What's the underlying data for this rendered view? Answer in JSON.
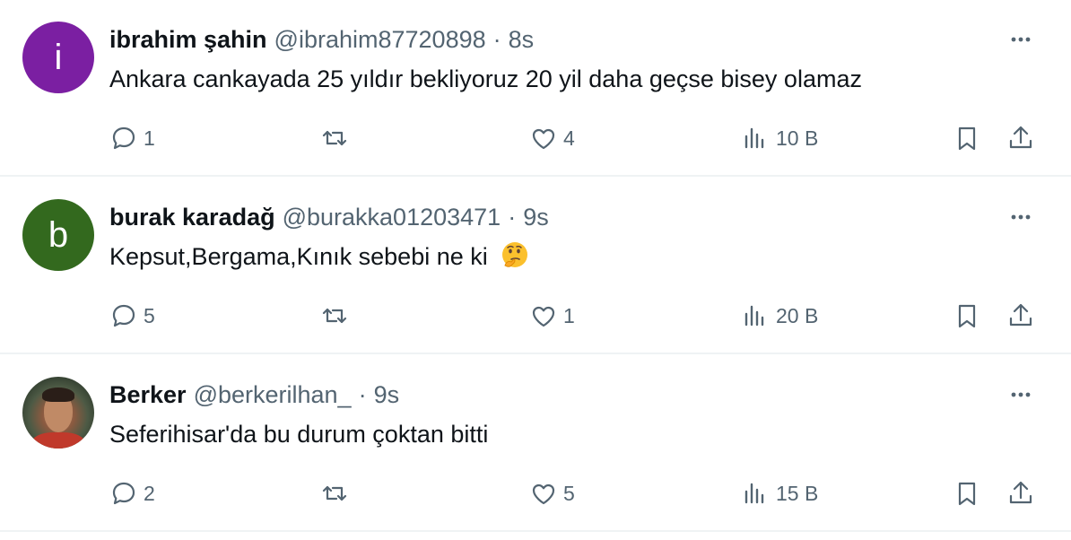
{
  "tweets": [
    {
      "avatar_letter": "i",
      "avatar_color": "#7b1fa2",
      "name": "ibrahim şahin",
      "handle": "@ibrahim87720898",
      "dot": "·",
      "time": "8s",
      "text": "Ankara cankayada 25 yıldır bekliyoruz 20 yil daha geçse bisey olamaz",
      "emoji": "",
      "replies": "1",
      "retweets": "",
      "likes": "4",
      "views": "10 B"
    },
    {
      "avatar_letter": "b",
      "avatar_color": "#33691e",
      "name": "burak karadağ",
      "handle": "@burakka01203471",
      "dot": "·",
      "time": "9s",
      "text": "Kepsut,Bergama,Kınık  sebebi ne ki",
      "emoji": "thinking-face-emoji",
      "replies": "5",
      "retweets": "",
      "likes": "1",
      "views": "20 B"
    },
    {
      "avatar_letter": "",
      "avatar_color": "",
      "name": "Berker",
      "handle": "@berkerilhan_",
      "dot": "·",
      "time": "9s",
      "text": "Seferihisar'da bu durum çoktan bitti",
      "emoji": "",
      "replies": "2",
      "retweets": "",
      "likes": "5",
      "views": "15 B"
    }
  ],
  "icons": {
    "reply": "reply-icon",
    "retweet": "retweet-icon",
    "like": "heart-icon",
    "views": "views-icon",
    "bookmark": "bookmark-icon",
    "share": "share-icon",
    "more": "more-icon"
  },
  "colors": {
    "text_primary": "#0f1419",
    "text_secondary": "#536471",
    "divider": "#eff3f4"
  }
}
